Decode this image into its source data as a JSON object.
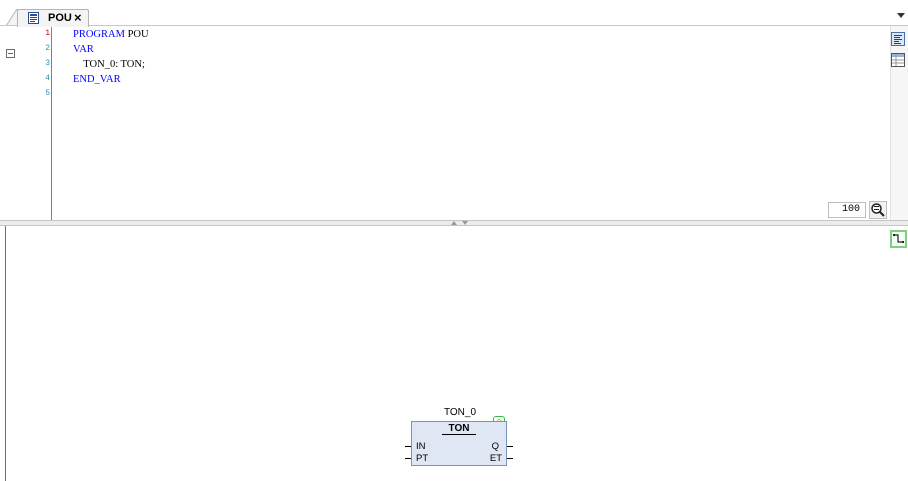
{
  "tab": {
    "title": "POU",
    "close_symbol": "×",
    "icon": "pou-document-icon"
  },
  "declaration": {
    "line_numbers": [
      "1",
      "2",
      "3",
      "4",
      "5"
    ],
    "lines": [
      {
        "keyword": "PROGRAM",
        "rest": " POU"
      },
      {
        "keyword": "VAR",
        "rest": ""
      },
      {
        "keyword": "",
        "rest": "    TON_0: TON;"
      },
      {
        "keyword": "END_VAR",
        "rest": ""
      },
      {
        "keyword": "",
        "rest": ""
      }
    ],
    "zoom": "100"
  },
  "fbd": {
    "block": {
      "instance_name": "TON_0",
      "type_name": "TON",
      "badge": "0",
      "inputs": [
        "IN",
        "PT"
      ],
      "outputs": [
        "Q",
        "ET"
      ]
    }
  },
  "colors": {
    "keyword": "#0000ff",
    "line_number": "#2b91af",
    "block_fill": "#dfe7f4",
    "badge_border": "#3cb83c"
  }
}
